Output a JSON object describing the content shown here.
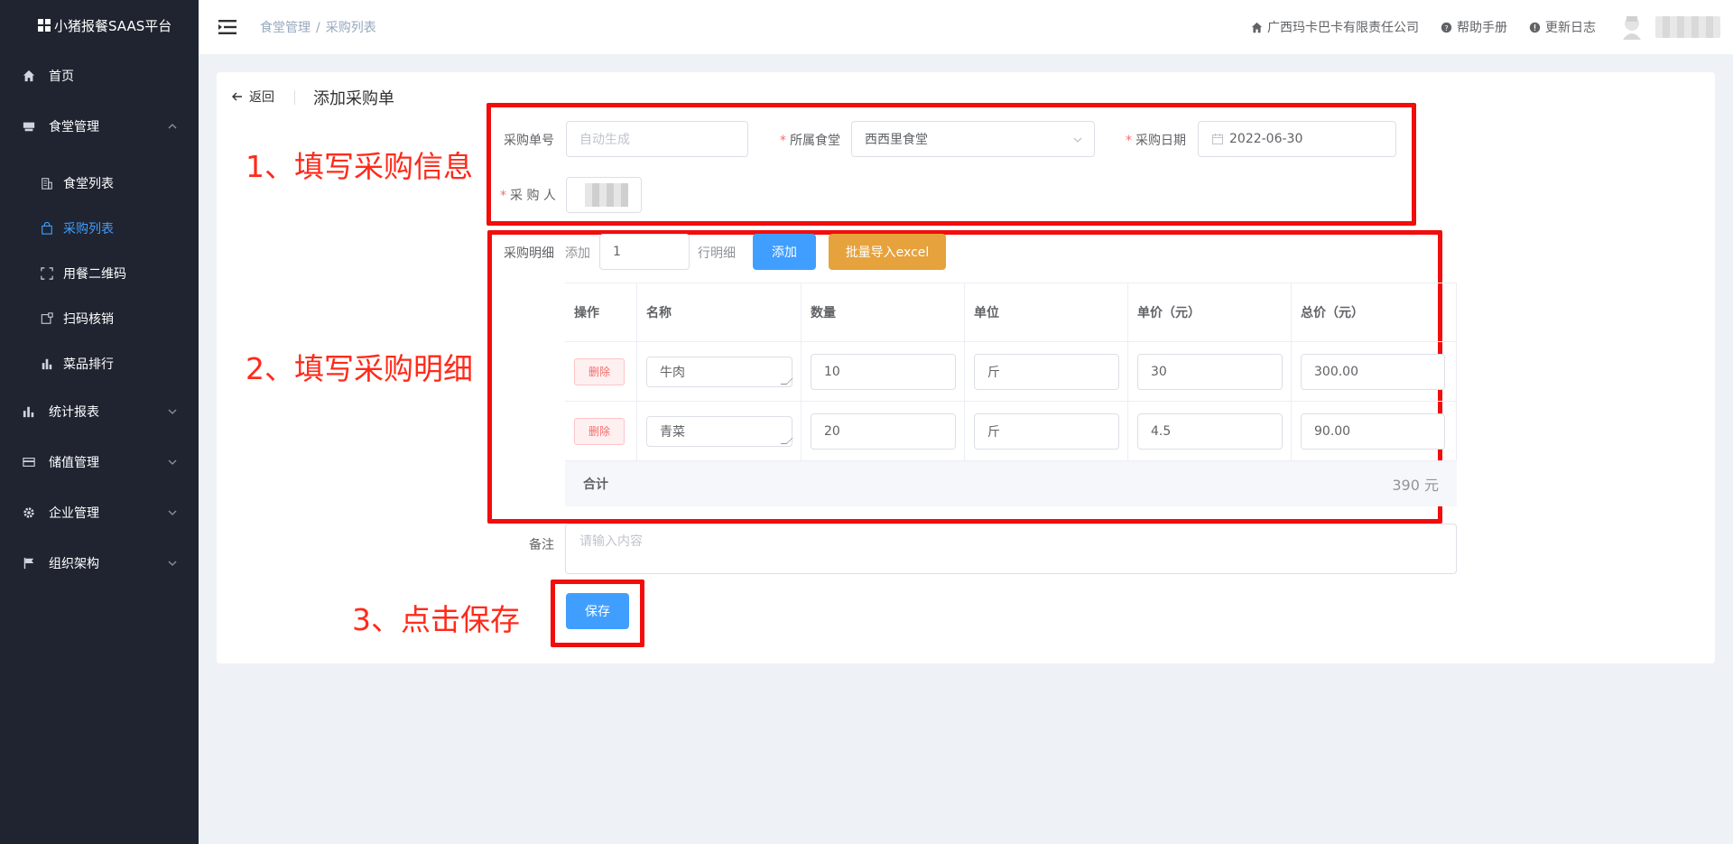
{
  "app": {
    "title": "小猪报餐SAAS平台"
  },
  "sidebar": {
    "items": [
      {
        "label": "首页",
        "icon": "home-icon"
      },
      {
        "label": "食堂管理",
        "icon": "canteen-icon",
        "expanded": true,
        "children": [
          {
            "label": "食堂列表",
            "icon": "building-icon"
          },
          {
            "label": "采购列表",
            "icon": "bag-icon",
            "active": true
          },
          {
            "label": "用餐二维码",
            "icon": "scan-frame-icon"
          },
          {
            "label": "扫码核销",
            "icon": "scan-verify-icon"
          },
          {
            "label": "菜品排行",
            "icon": "bar-chart-icon"
          }
        ]
      },
      {
        "label": "统计报表",
        "icon": "stats-icon"
      },
      {
        "label": "储值管理",
        "icon": "card-icon"
      },
      {
        "label": "企业管理",
        "icon": "gear-icon"
      },
      {
        "label": "组织架构",
        "icon": "flag-icon"
      }
    ]
  },
  "header": {
    "breadcrumb": [
      "食堂管理",
      "采购列表"
    ],
    "company": "广西玛卡巴卡有限责任公司",
    "help": "帮助手册",
    "changelog": "更新日志"
  },
  "page": {
    "back_label": "返回",
    "title": "添加采购单"
  },
  "annotations": {
    "step1": "1、填写采购信息",
    "step2": "2、填写采购明细",
    "step3": "3、点击保存"
  },
  "form": {
    "order_no_label": "采购单号",
    "order_no_placeholder": "自动生成",
    "canteen_label": "所属食堂",
    "canteen_value": "西西里食堂",
    "date_label": "采购日期",
    "date_value": "2022-06-30",
    "buyer_label": "采 购 人",
    "detail_label": "采购明细",
    "add_prefix": "添加",
    "add_count": "1",
    "add_suffix": "行明细",
    "add_button": "添加",
    "import_button": "批量导入excel",
    "remark_label": "备注",
    "remark_placeholder": "请输入内容",
    "save_button": "保存"
  },
  "table": {
    "headers": [
      "操作",
      "名称",
      "数量",
      "单位",
      "单价（元）",
      "总价（元）"
    ],
    "delete_label": "删除",
    "rows": [
      {
        "name": "牛肉",
        "qty": "10",
        "unit": "斤",
        "price": "30",
        "total": "300.00"
      },
      {
        "name": "青菜",
        "qty": "20",
        "unit": "斤",
        "price": "4.5",
        "total": "90.00"
      }
    ],
    "sum_label": "合计",
    "sum_value": "390 元"
  },
  "colors": {
    "accent": "#409eff",
    "warning": "#e6a23c",
    "danger": "#f56c6c",
    "annotation": "#ff2a1a",
    "sidebar_bg": "#1f2430"
  }
}
